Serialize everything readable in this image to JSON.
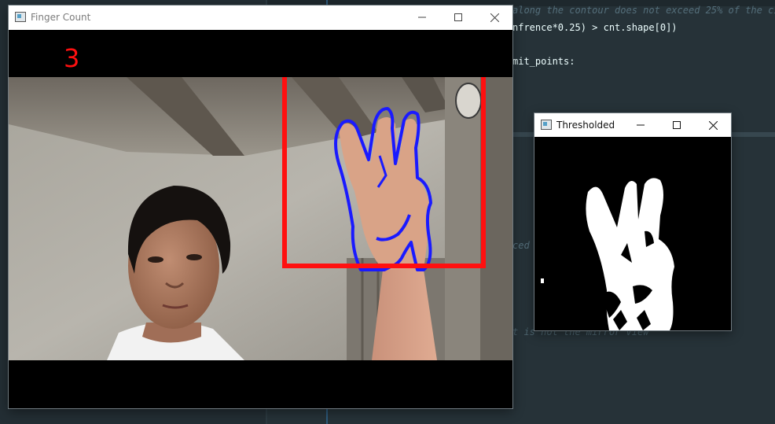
{
  "finger_window": {
    "title": "Finger Count",
    "finger_count": "3"
  },
  "thresh_window": {
    "title": "Thresholded"
  },
  "editor": {
    "lines": [
      "along the contour does not exceed 25% of the ci",
      "nfrence*0.25) > cnt.shape[0])",
      "mit_points:",
      "ced",
      "t is not the mirror view"
    ]
  },
  "colors": {
    "roi_box": "#ff1010",
    "contour": "#1a1aff",
    "count_text": "#ff1010"
  },
  "icons": [
    "minimize-icon",
    "maximize-icon",
    "close-icon",
    "app-icon"
  ]
}
